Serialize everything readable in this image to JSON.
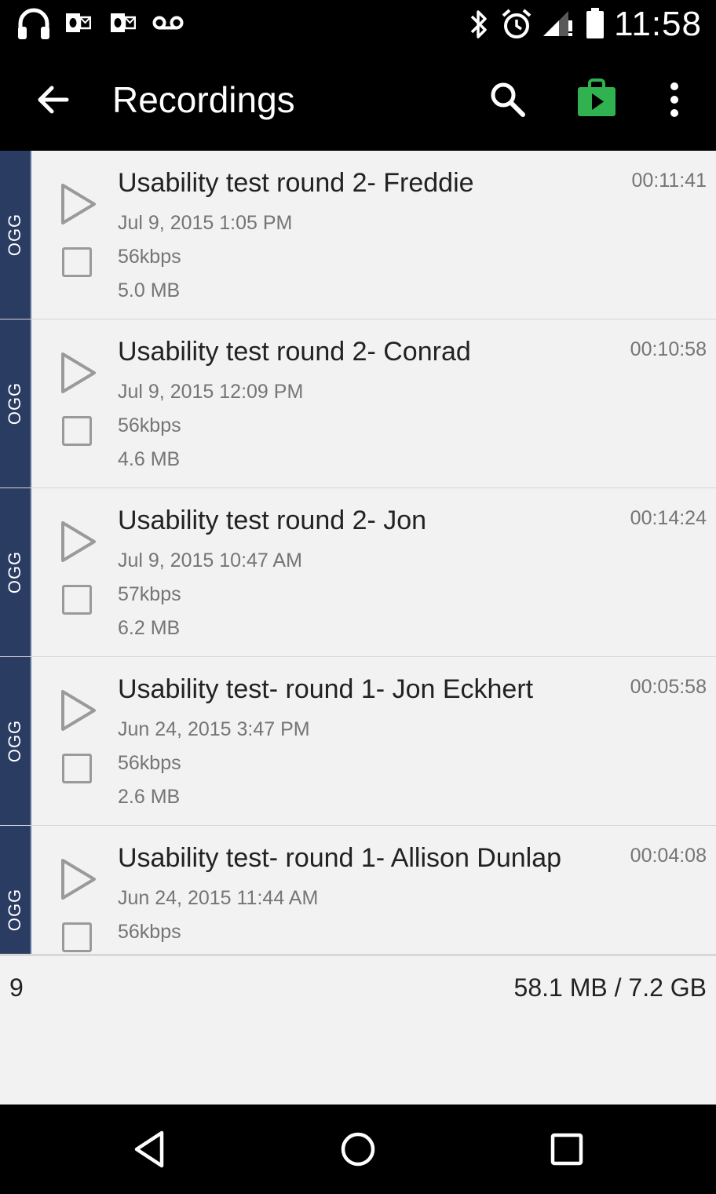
{
  "status_bar": {
    "time": "11:58",
    "left_icons": [
      "headphones-icon",
      "outlook-icon",
      "outlook-icon",
      "voicemail-icon"
    ],
    "right_icons": [
      "bluetooth-icon",
      "alarm-icon",
      "signal-icon",
      "battery-icon"
    ]
  },
  "toolbar": {
    "title": "Recordings",
    "back_icon": "arrow-left-icon",
    "search_icon": "search-icon",
    "store_icon": "play-store-icon",
    "store_color": "#2fb24f",
    "menu_icon": "more-vert-icon"
  },
  "recordings": [
    {
      "format": "OGG",
      "title": "Usability test round 2- Freddie",
      "date": "Jul 9, 2015 1:05 PM",
      "bitrate": "56kbps",
      "size": "5.0 MB",
      "duration": "00:11:41"
    },
    {
      "format": "OGG",
      "title": "Usability test round 2- Conrad",
      "date": "Jul 9, 2015 12:09 PM",
      "bitrate": "56kbps",
      "size": "4.6 MB",
      "duration": "00:10:58"
    },
    {
      "format": "OGG",
      "title": "Usability test round 2- Jon",
      "date": "Jul 9, 2015 10:47 AM",
      "bitrate": "57kbps",
      "size": "6.2 MB",
      "duration": "00:14:24"
    },
    {
      "format": "OGG",
      "title": "Usability test- round 1- Jon Eckhert",
      "date": "Jun 24, 2015 3:47 PM",
      "bitrate": "56kbps",
      "size": "2.6 MB",
      "duration": "00:05:58"
    },
    {
      "format": "OGG",
      "title": "Usability test- round 1- Allison Dunlap",
      "date": "Jun 24, 2015 11:44 AM",
      "bitrate": "56kbps",
      "size": "",
      "duration": "00:04:08"
    }
  ],
  "footer": {
    "count": "9",
    "storage": "58.1 MB / 7.2 GB"
  },
  "colors": {
    "format_tag_bg": "#2b3c62",
    "list_bg": "#f2f2f2"
  }
}
